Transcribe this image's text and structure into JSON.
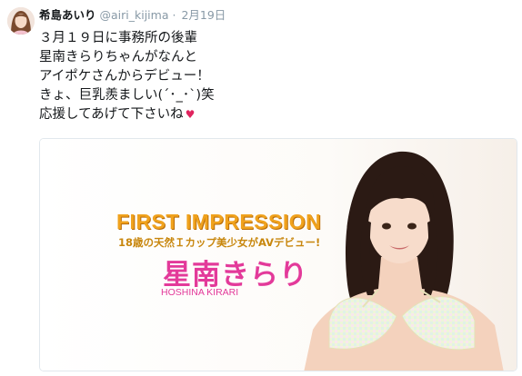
{
  "tweet": {
    "display_name": "希島あいり",
    "handle": "@airi_kijima",
    "separator": "·",
    "date": "2月19日",
    "lines": [
      "３月１９日に事務所の後輩",
      "星南きらりちゃんがなんと",
      "アイポケさんからデビュー！",
      "きょ、巨乳羨ましい(´･_･`)笑",
      "応援してあげて下さいね"
    ],
    "heart_glyph": "♥"
  },
  "media_card": {
    "title": "FIRST IMPRESSION",
    "subtitle": "18歳の天然Ｉカップ美少女がAVデビュー!",
    "model_name": "星南きらり",
    "model_romaji": "HOSHINA KIRARI"
  },
  "colors": {
    "accent_orange": "#f0a21d",
    "accent_pink": "#e33a9a",
    "heart": "#e0245e",
    "muted": "#8899a6"
  }
}
